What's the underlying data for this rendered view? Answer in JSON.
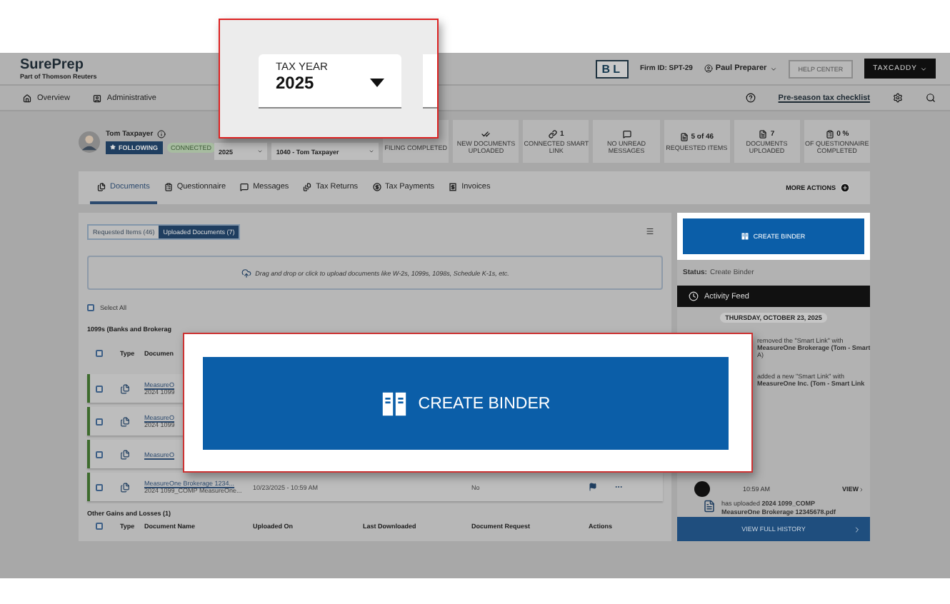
{
  "header": {
    "logo": "SurePrep",
    "logo_sub": "Part of Thomson Reuters",
    "firm_badge": "BL",
    "firm_id": "Firm ID: SPT-29",
    "user": "Paul Preparer",
    "buttons": [
      "HELP CENTER",
      "TAXCADDY"
    ]
  },
  "nav": {
    "items": [
      {
        "label": "Overview",
        "kind": "home"
      },
      {
        "label": "Administrative",
        "kind": "user"
      }
    ],
    "checklist_link": "Pre-season tax checklist"
  },
  "taxpayer": {
    "name": "Tom Taxpayer",
    "follow_button": "FOLLOWING",
    "status": "CONNECTED",
    "tax_year": "2025",
    "return": "1040 - Tom Taxpayer"
  },
  "stats": [
    {
      "label": "FILING COMPLETED"
    },
    {
      "kind": "check",
      "label": "NEW DOCUMENTS UPLOADED"
    },
    {
      "kind": "link",
      "value": "1",
      "label": "CONNECTED SMART LINK"
    },
    {
      "kind": "message",
      "label": "NO UNREAD MESSAGES"
    },
    {
      "kind": "document",
      "value": "5 of 46",
      "label": "REQUESTED ITEMS"
    },
    {
      "kind": "document",
      "value": "7",
      "label": "DOCUMENTS UPLOADED"
    },
    {
      "kind": "clipboard",
      "value": "0 %",
      "label": "OF QUESTIONNAIRE COMPLETED"
    }
  ],
  "tabs": [
    {
      "label": "Documents",
      "kind": "documents",
      "selected": true
    },
    {
      "label": "Questionnaire",
      "kind": "clipboard",
      "selected": false
    },
    {
      "label": "Messages",
      "kind": "message",
      "selected": false
    },
    {
      "label": "Tax Returns",
      "kind": "returns",
      "selected": false
    },
    {
      "label": "Tax Payments",
      "kind": "payments",
      "selected": false
    },
    {
      "label": "Invoices",
      "kind": "invoice",
      "selected": false
    }
  ],
  "more_actions": "MORE ACTIONS",
  "documents": {
    "toggle": [
      {
        "label": "Requested Items (46)",
        "selected": false
      },
      {
        "label": "Uploaded Documents (7)",
        "selected": true
      }
    ],
    "dropzone": "Drag and drop or click to upload documents like W-2s, 1099s, 1098s, Schedule K-1s, etc.",
    "select_all": {
      "label": "Select All",
      "checked": false
    },
    "groups": [
      {
        "title": "1099s (Banks and Brokerag",
        "all_checked": false,
        "columns": [
          "Type",
          "Documen"
        ],
        "rows": [
          {
            "name": "MeasureO",
            "subtitle": "2024 1099",
            "checked": false
          },
          {
            "name": "MeasureO",
            "subtitle": "2024 1099",
            "checked": false
          },
          {
            "name": "MeasureO",
            "checked": false
          },
          {
            "name": "MeasureOne Brokerage 1234...",
            "subtitle": "2024 1099_COMP MeasureOne...",
            "uploaded": "10/23/2025 - 10:59 AM",
            "request": "No",
            "checked": false
          }
        ]
      },
      {
        "title": "Other Gains and Losses (1)",
        "all_checked": false,
        "columns": [
          "Type",
          "Document Name",
          "Uploaded On",
          "Last Downloaded",
          "Document Request",
          "Actions"
        ]
      }
    ]
  },
  "side": {
    "create_binder": "CREATE BINDER",
    "status_label": "Status:",
    "status": "Create Binder",
    "activity_title": "Activity Feed",
    "date": "THURSDAY, OCTOBER 23, 2025",
    "feed": [
      {
        "lines": [
          "removed the \"Smart Link\" with",
          "MeasureOne Brokerage (Tom - Smart",
          "A)"
        ]
      },
      {
        "lines": [
          "added a new \"Smart Link\" with",
          "MeasureOne Inc. (Tom - Smart Link"
        ]
      }
    ],
    "entry": {
      "time": "10:59 AM",
      "view": "VIEW",
      "upload_text": "has uploaded **2024 1099_COMP MeasureOne Brokerage 12345678.pdf**"
    },
    "full_history": "VIEW FULL HISTORY"
  },
  "callouts": {
    "tax_year_label": "TAX YEAR",
    "tax_year": "2025",
    "create_binder": "CREATE BINDER"
  }
}
